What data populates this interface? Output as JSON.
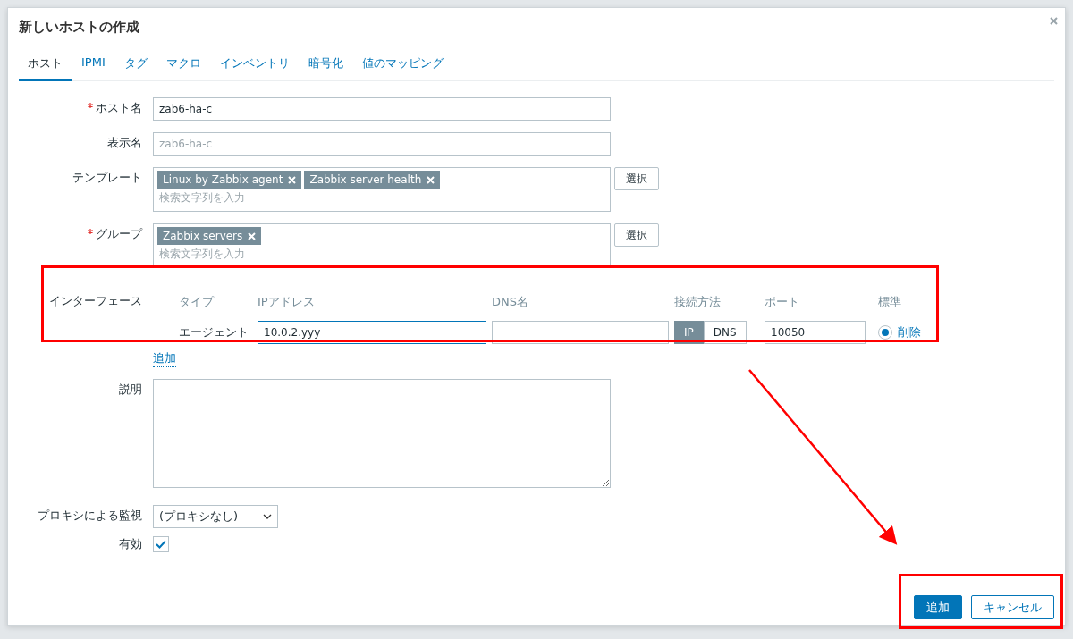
{
  "dialog": {
    "title": "新しいホストの作成"
  },
  "tabs": [
    {
      "label": "ホスト",
      "selected": true
    },
    {
      "label": "IPMI",
      "selected": false
    },
    {
      "label": "タグ",
      "selected": false
    },
    {
      "label": "マクロ",
      "selected": false
    },
    {
      "label": "インベントリ",
      "selected": false
    },
    {
      "label": "暗号化",
      "selected": false
    },
    {
      "label": "値のマッピング",
      "selected": false
    }
  ],
  "form": {
    "host_name": {
      "label": "ホスト名",
      "required": true,
      "value": "zab6-ha-c"
    },
    "visible_name": {
      "label": "表示名",
      "placeholder": "zab6-ha-c"
    },
    "templates": {
      "label": "テンプレート",
      "tags": [
        "Linux by Zabbix agent",
        "Zabbix server health"
      ],
      "placeholder": "検索文字列を入力",
      "button": "選択"
    },
    "groups": {
      "label": "グループ",
      "required": true,
      "tags": [
        "Zabbix servers"
      ],
      "placeholder": "検索文字列を入力",
      "button": "選択"
    },
    "interfaces": {
      "label": "インターフェース",
      "columns": [
        "タイプ",
        "IPアドレス",
        "DNS名",
        "接続方法",
        "ポート",
        "標準"
      ],
      "rows": [
        {
          "type": "エージェント",
          "ip": "10.0.2.yyy",
          "connect_options": [
            {
              "label": "IP",
              "selected": true
            },
            {
              "label": "DNS",
              "selected": false
            }
          ],
          "port": "10050",
          "default": true,
          "remove": "削除"
        }
      ],
      "add_link": "追加"
    },
    "description": {
      "label": "説明"
    },
    "proxy": {
      "label": "プロキシによる監視",
      "value": "(プロキシなし)"
    },
    "enabled": {
      "label": "有効",
      "checked": true
    }
  },
  "buttons": [
    {
      "label": "追加",
      "kind": "primary"
    },
    {
      "label": "キャンセル",
      "kind": "secondary"
    }
  ]
}
